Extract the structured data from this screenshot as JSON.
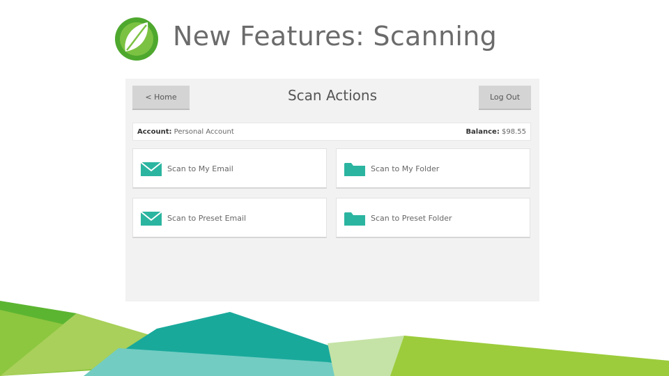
{
  "slide": {
    "title": "New Features: Scanning"
  },
  "screen": {
    "home_label": "< Home",
    "title": "Scan Actions",
    "logout_label": "Log Out",
    "account_label": "Account:",
    "account_value": "Personal Account",
    "balance_label": "Balance:",
    "balance_value": "$98.55"
  },
  "tiles": [
    {
      "label": "Scan to My Email",
      "icon": "envelope-icon"
    },
    {
      "label": "Scan to My Folder",
      "icon": "folder-icon"
    },
    {
      "label": "Scan to Preset Email",
      "icon": "envelope-icon"
    },
    {
      "label": "Scan to Preset Folder",
      "icon": "folder-icon"
    }
  ],
  "colors": {
    "accent": "#2bb5a0",
    "leaf_green": "#5cb531",
    "title_gray": "#6b6b6b"
  }
}
